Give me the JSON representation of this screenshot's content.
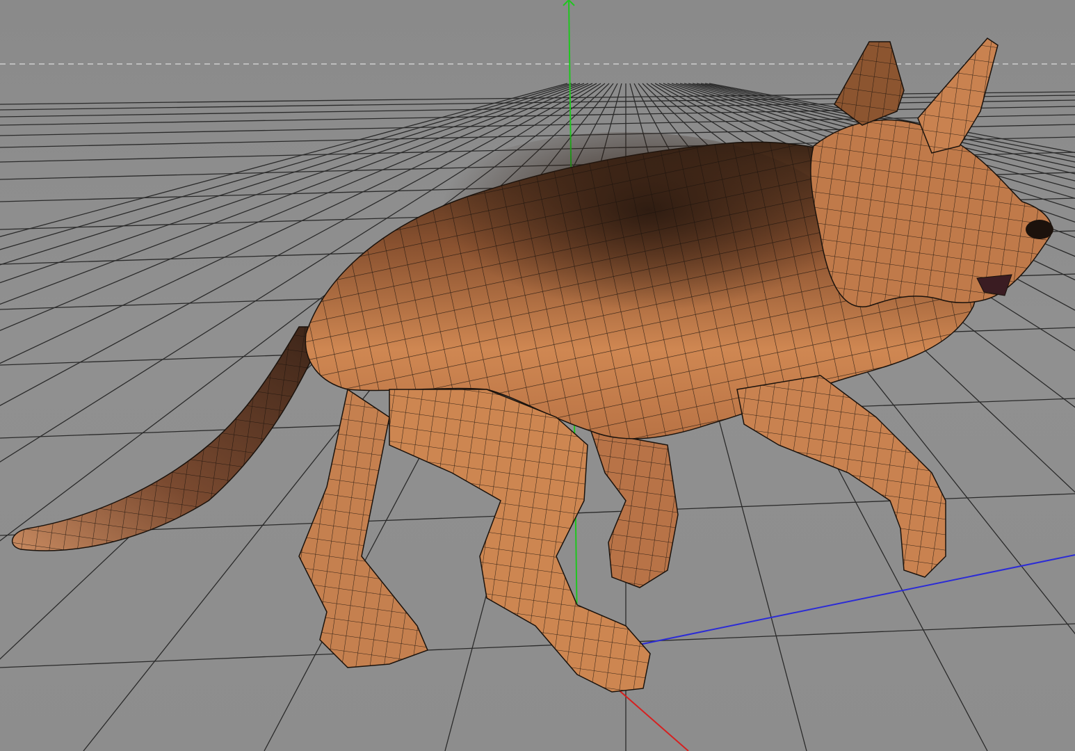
{
  "viewport": {
    "mode": "3d-perspective",
    "background_color": "#8c8c8c",
    "grid_color": "#2a2a2a",
    "horizon_line_color": "#cfcfcf",
    "show_grid": true
  },
  "axes": {
    "y_color": "#1fc61f",
    "z_color": "#2b2bd6",
    "x_color": "#d62020"
  },
  "model": {
    "subject": "german-shepherd-dog",
    "display": "textured-with-wireframe",
    "fur_light": "#d0814e",
    "fur_dark": "#2a1a12",
    "wire_color": "#1a120c"
  }
}
